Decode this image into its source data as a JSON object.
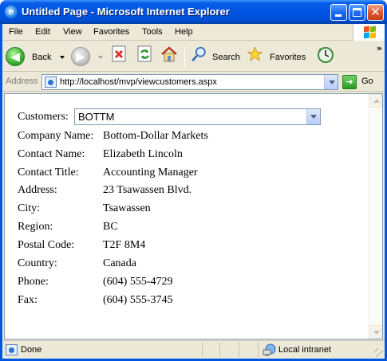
{
  "window": {
    "title": "Untitled Page - Microsoft Internet Explorer",
    "app_icon": "ie-icon",
    "controls": [
      "minimize-icon",
      "maximize-icon",
      "close-icon"
    ],
    "title_bar_color": "#0054e3"
  },
  "menu": {
    "items": [
      "File",
      "Edit",
      "View",
      "Favorites",
      "Tools",
      "Help"
    ],
    "logo_icon": "windows-flag-icon"
  },
  "toolbar": {
    "back_label": "Back",
    "search_label": "Search",
    "favorites_label": "Favorites",
    "icons": [
      "back-arrow-icon",
      "forward-arrow-icon",
      "stop-icon",
      "refresh-icon",
      "home-icon",
      "search-icon",
      "favorites-star-icon",
      "history-icon"
    ],
    "overflow": "»"
  },
  "address": {
    "label": "Address",
    "url": "http://localhost/mvp/viewcustomers.aspx",
    "go_label": "Go"
  },
  "page": {
    "customers_label": "Customers:",
    "selected_customer": "BOTTM",
    "fields": [
      {
        "label": "Company Name:",
        "value": "Bottom-Dollar Markets"
      },
      {
        "label": "Contact Name:",
        "value": "Elizabeth Lincoln"
      },
      {
        "label": "Contact Title:",
        "value": "Accounting Manager"
      },
      {
        "label": "Address:",
        "value": "23 Tsawassen Blvd."
      },
      {
        "label": "City:",
        "value": "Tsawassen"
      },
      {
        "label": "Region:",
        "value": "BC"
      },
      {
        "label": "Postal Code:",
        "value": "T2F 8M4"
      },
      {
        "label": "Country:",
        "value": "Canada"
      },
      {
        "label": "Phone:",
        "value": "(604) 555-4729"
      },
      {
        "label": "Fax:",
        "value": "(604) 555-3745"
      }
    ]
  },
  "status": {
    "text": "Done",
    "zone": "Local intranet"
  }
}
